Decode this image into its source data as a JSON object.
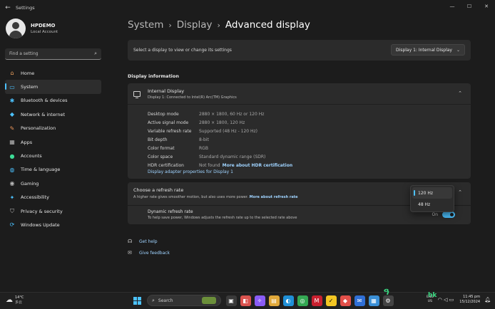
{
  "window": {
    "title": "Settings",
    "controls": {
      "minimize": "—",
      "maximize": "☐",
      "close": "✕"
    },
    "back_glyph": "←"
  },
  "profile": {
    "name": "HPDEMO",
    "subtitle": "Local Account"
  },
  "search": {
    "placeholder": "Find a setting"
  },
  "sidebar": {
    "items": [
      {
        "label": "Home",
        "icon": "home-icon",
        "glyph": "⌂",
        "color": "#f0a35e"
      },
      {
        "label": "System",
        "icon": "system-icon",
        "glyph": "▭",
        "color": "#4cc2ff",
        "active": true
      },
      {
        "label": "Bluetooth & devices",
        "icon": "bluetooth-icon",
        "glyph": "✱",
        "color": "#4cc2ff"
      },
      {
        "label": "Network & internet",
        "icon": "network-icon",
        "glyph": "◆",
        "color": "#4cc2ff"
      },
      {
        "label": "Personalization",
        "icon": "brush-icon",
        "glyph": "✎",
        "color": "#e8945a"
      },
      {
        "label": "Apps",
        "icon": "apps-icon",
        "glyph": "▦",
        "color": "#b9b9b9"
      },
      {
        "label": "Accounts",
        "icon": "accounts-icon",
        "glyph": "●",
        "color": "#3ddc97"
      },
      {
        "label": "Time & language",
        "icon": "globe-icon",
        "glyph": "◍",
        "color": "#4cc2ff"
      },
      {
        "label": "Gaming",
        "icon": "gamepad-icon",
        "glyph": "◉",
        "color": "#b9b9b9"
      },
      {
        "label": "Accessibility",
        "icon": "accessibility-icon",
        "glyph": "✦",
        "color": "#4cc2ff"
      },
      {
        "label": "Privacy & security",
        "icon": "shield-icon",
        "glyph": "⛉",
        "color": "#b9b9b9"
      },
      {
        "label": "Windows Update",
        "icon": "update-icon",
        "glyph": "⟳",
        "color": "#4cc2ff"
      }
    ]
  },
  "breadcrumb": {
    "items": [
      "System",
      "Display"
    ],
    "current": "Advanced display",
    "sep": "›"
  },
  "display_select": {
    "label": "Select a display to view or change its settings",
    "value": "Display 1: Internal Display",
    "chevron": "⌄"
  },
  "display_info": {
    "section_title": "Display information",
    "name": "Internal Display",
    "subtitle": "Display 1: Connected to Intel(R) Arc(TM) Graphics",
    "collapse_glyph": "⌃",
    "specs": [
      {
        "key": "Desktop mode",
        "value": "2880 × 1800, 60 Hz or 120 Hz"
      },
      {
        "key": "Active signal mode",
        "value": "2880 × 1800, 120 Hz"
      },
      {
        "key": "Variable refresh rate",
        "value": "Supported (48 Hz - 120 Hz)"
      },
      {
        "key": "Bit depth",
        "value": "8-bit"
      },
      {
        "key": "Color format",
        "value": "RGB"
      },
      {
        "key": "Color space",
        "value": "Standard dynamic range (SDR)"
      },
      {
        "key": "HDR certification",
        "value": "Not found",
        "link": "More about HDR certification"
      }
    ],
    "adapter_link": "Display adapter properties for Display 1"
  },
  "refresh": {
    "title": "Choose a refresh rate",
    "desc": "A higher rate gives smoother motion, but also uses more power.",
    "link": "More about refresh rate",
    "options": [
      "120 Hz",
      "48 Hz"
    ],
    "selected": "120 Hz"
  },
  "dynamic": {
    "title": "Dynamic refresh rate",
    "desc": "To help save power, Windows adjusts the refresh rate up to the selected rate above",
    "state_label": "On"
  },
  "help": {
    "get_help": "Get help",
    "give_feedback": "Give feedback"
  },
  "taskbar": {
    "weather_temp": "14°C",
    "weather_desc": "多云",
    "search_label": "Search",
    "lang_line1": "ENG",
    "lang_line2": "US",
    "time": "11:45 pm",
    "date": "15/12/2024",
    "overlay1": "ዓ",
    "overlay2": "hk"
  }
}
